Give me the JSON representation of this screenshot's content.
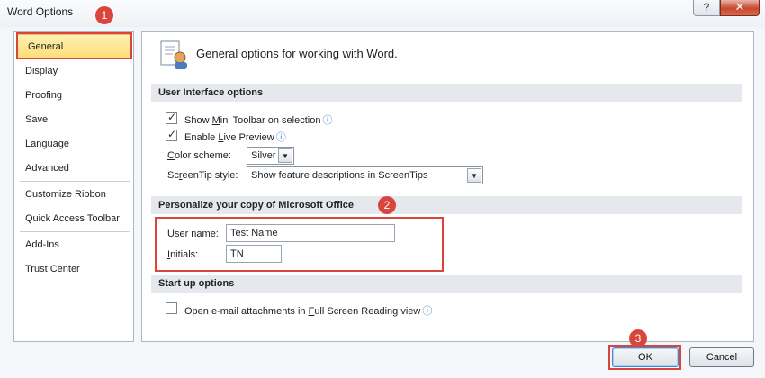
{
  "window": {
    "title": "Word Options",
    "help_label": "?",
    "close_label": "✕"
  },
  "sidebar": {
    "items": [
      {
        "label": "General"
      },
      {
        "label": "Display"
      },
      {
        "label": "Proofing"
      },
      {
        "label": "Save"
      },
      {
        "label": "Language"
      },
      {
        "label": "Advanced"
      },
      {
        "label": "Customize Ribbon"
      },
      {
        "label": "Quick Access Toolbar"
      },
      {
        "label": "Add-Ins"
      },
      {
        "label": "Trust Center"
      }
    ],
    "selected": "General"
  },
  "header": {
    "title": "General options for working with Word."
  },
  "ui_options": {
    "title": "User Interface options",
    "mini_toolbar": {
      "pre": "Show ",
      "key": "M",
      "post": "ini Toolbar on selection",
      "checked": true
    },
    "live_preview": {
      "pre": "Enable ",
      "key": "L",
      "post": "ive Preview",
      "checked": true
    },
    "color_scheme": {
      "key": "C",
      "post": "olor scheme:",
      "value": "Silver"
    },
    "screentip": {
      "pre": "Sc",
      "key": "r",
      "post": "eenTip style:",
      "value": "Show feature descriptions in ScreenTips"
    }
  },
  "personalize": {
    "title": "Personalize your copy of Microsoft Office",
    "username": {
      "key": "U",
      "post": "ser name:",
      "value": "Test Name"
    },
    "initials": {
      "key": "I",
      "post": "nitials:",
      "value": "TN"
    }
  },
  "startup": {
    "title": "Start up options",
    "open_email": {
      "pre": "Open e-mail attachments in ",
      "key": "F",
      "post": "ull Screen Reading view",
      "checked": false
    }
  },
  "buttons": {
    "ok": "OK",
    "cancel": "Cancel"
  },
  "annotations": {
    "badge1": "1",
    "badge2": "2",
    "badge3": "3",
    "color": "#d9453d"
  },
  "info_icon": "info-icon"
}
